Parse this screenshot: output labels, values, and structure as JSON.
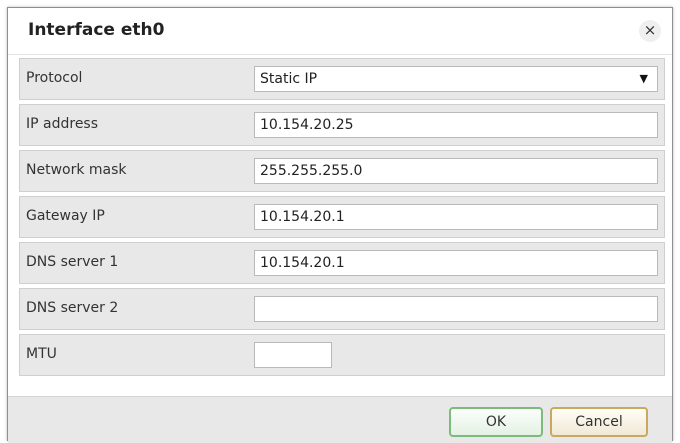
{
  "dialog": {
    "title": "Interface eth0",
    "close_symbol": "×"
  },
  "form": {
    "protocol": {
      "label": "Protocol",
      "value": "Static IP",
      "caret": "▼"
    },
    "ip_address": {
      "label": "IP address",
      "value": "10.154.20.25"
    },
    "network_mask": {
      "label": "Network mask",
      "value": "255.255.255.0"
    },
    "gateway_ip": {
      "label": "Gateway IP",
      "value": "10.154.20.1"
    },
    "dns_server_1": {
      "label": "DNS server 1",
      "value": "10.154.20.1"
    },
    "dns_server_2": {
      "label": "DNS server 2",
      "value": ""
    },
    "mtu": {
      "label": "MTU",
      "value": ""
    }
  },
  "footer": {
    "ok_label": "OK",
    "cancel_label": "Cancel"
  },
  "colors": {
    "row_background": "#e8e8e8",
    "ok_border": "#7dbb7d",
    "cancel_border": "#c9a95e"
  }
}
